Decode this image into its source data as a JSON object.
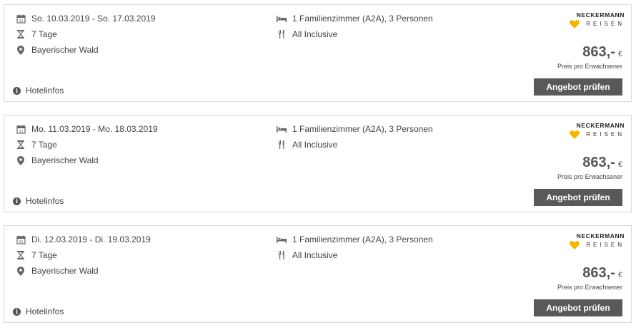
{
  "offers": [
    {
      "dates": "So. 10.03.2019 - So. 17.03.2019",
      "duration": "7 Tage",
      "location": "Bayerischer Wald",
      "room": "1 Familienzimmer (A2A), 3 Personen",
      "board": "All Inclusive",
      "price": "863,-",
      "currency": "€",
      "price_note": "Preis pro Erwachsener",
      "cta": "Angebot prüfen",
      "hotelinfo": "Hotelinfos",
      "brand_top": "NECKERMANN",
      "brand_bottom": "REISEN"
    },
    {
      "dates": "Mo. 11.03.2019 - Mo. 18.03.2019",
      "duration": "7 Tage",
      "location": "Bayerischer Wald",
      "room": "1 Familienzimmer (A2A), 3 Personen",
      "board": "All Inclusive",
      "price": "863,-",
      "currency": "€",
      "price_note": "Preis pro Erwachsener",
      "cta": "Angebot prüfen",
      "hotelinfo": "Hotelinfos",
      "brand_top": "NECKERMANN",
      "brand_bottom": "REISEN"
    },
    {
      "dates": "Di. 12.03.2019 - Di. 19.03.2019",
      "duration": "7 Tage",
      "location": "Bayerischer Wald",
      "room": "1 Familienzimmer (A2A), 3 Personen",
      "board": "All Inclusive",
      "price": "863,-",
      "currency": "€",
      "price_note": "Preis pro Erwachsener",
      "cta": "Angebot prüfen",
      "hotelinfo": "Hotelinfos",
      "brand_top": "NECKERMANN",
      "brand_bottom": "REISEN"
    }
  ],
  "icons": {
    "date": "calendar-icon",
    "duration": "hourglass-icon",
    "location": "map-pin-icon",
    "room": "bed-icon",
    "board": "cutlery-icon",
    "info": "info-icon",
    "brand": "heart-logo-icon"
  },
  "colors": {
    "button_bg": "#595959",
    "border": "#d9d9d9",
    "brand_heart": "#f4b400"
  }
}
